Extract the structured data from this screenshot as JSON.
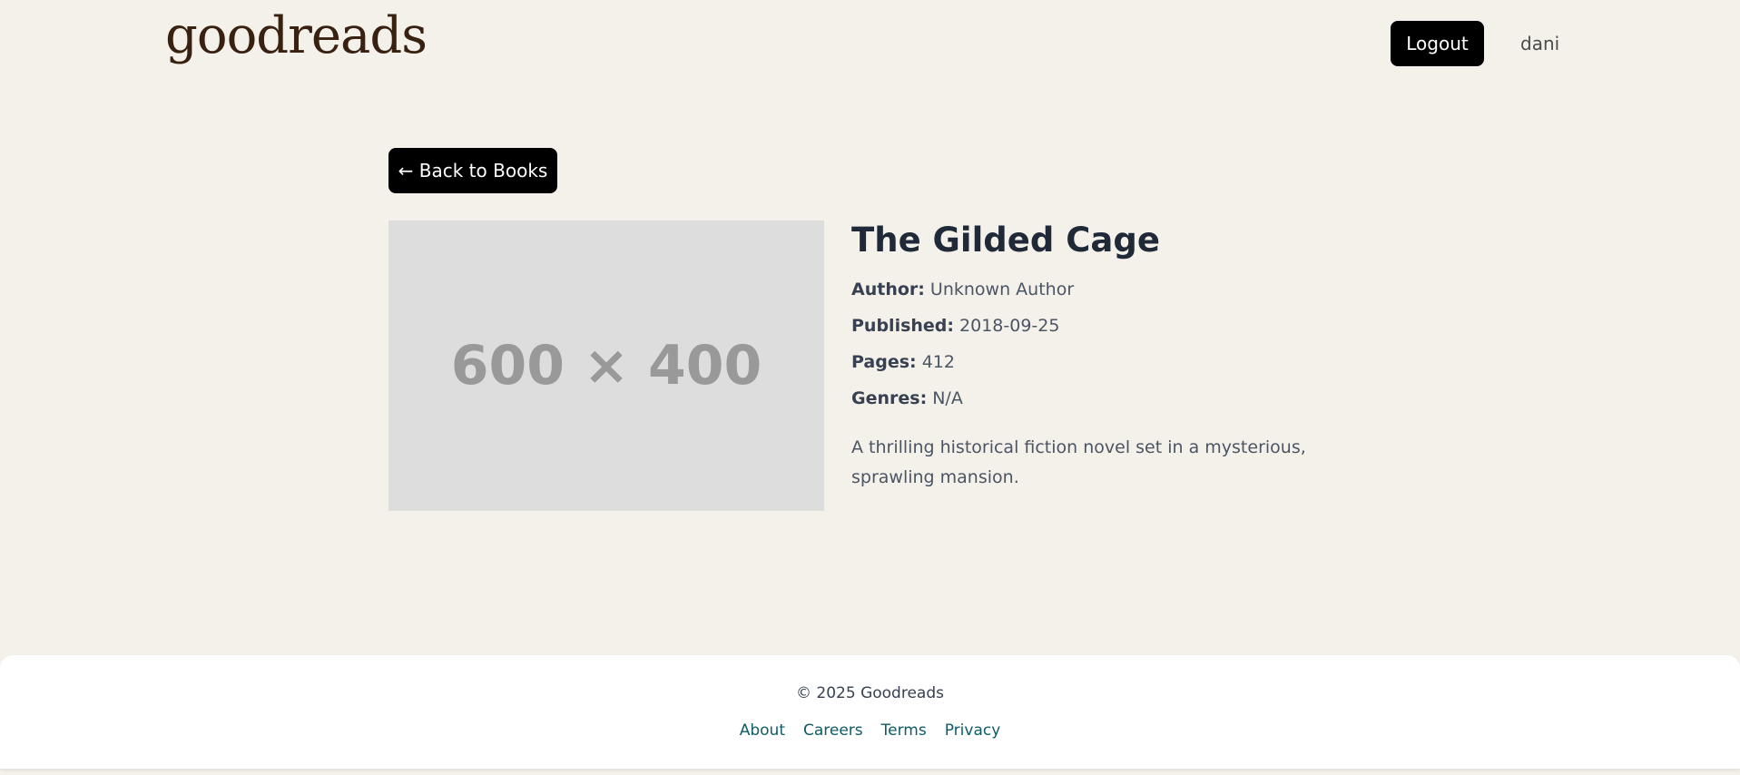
{
  "header": {
    "logo": "goodreads",
    "logout_label": "Logout",
    "username": "dani"
  },
  "nav": {
    "back_label": "← Back to Books"
  },
  "book": {
    "cover_placeholder": "600 × 400",
    "title": "The Gilded Cage",
    "author_label": "Author:",
    "author": "Unknown Author",
    "published_label": "Published:",
    "published": "2018-09-25",
    "pages_label": "Pages:",
    "pages": "412",
    "genres_label": "Genres:",
    "genres": "N/A",
    "description": "A thrilling historical fiction novel set in a mysterious, sprawling mansion."
  },
  "footer": {
    "copyright": "© 2025 Goodreads",
    "links": [
      "About",
      "Careers",
      "Terms",
      "Privacy"
    ]
  },
  "colors": {
    "background": "#f4f1eb",
    "logo": "#382110",
    "button": "#000000",
    "footer_link": "#0d5c63"
  }
}
